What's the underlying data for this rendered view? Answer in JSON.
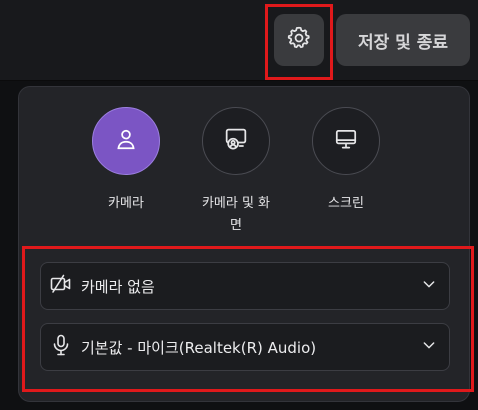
{
  "toolbar": {
    "save_end_label": "저장 및 종료"
  },
  "sources": [
    {
      "label": "카메라",
      "icon": "person-icon",
      "selected": true
    },
    {
      "label": "카메라 및 화면",
      "icon": "screen-with-person-icon",
      "selected": false
    },
    {
      "label": "스크린",
      "icon": "monitor-icon",
      "selected": false
    }
  ],
  "devices": {
    "camera": {
      "value": "카메라 없음",
      "icon": "camera-off-icon"
    },
    "microphone": {
      "value": "기본값 - 마이크(Realtek(R) Audio)",
      "icon": "microphone-icon"
    }
  },
  "colors": {
    "accent": "#7b55c4",
    "highlight": "#e0191b"
  }
}
